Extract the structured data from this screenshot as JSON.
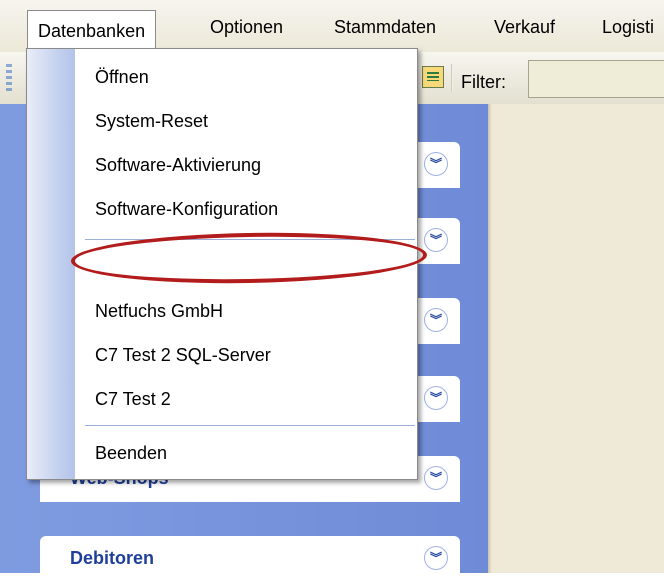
{
  "menubar": {
    "items": [
      "Datenbanken",
      "Optionen",
      "Stammdaten",
      "Verkauf",
      "Logisti"
    ]
  },
  "toolbar": {
    "filter_label": "Filter:",
    "filter_value": ""
  },
  "groups": [
    {
      "title": ""
    },
    {
      "title": ""
    },
    {
      "title": ""
    },
    {
      "title": ""
    },
    {
      "title": "Web-Shops"
    },
    {
      "title": "Debitoren"
    }
  ],
  "dropdown": {
    "items": [
      "Öffnen",
      "System-Reset",
      "Software-Aktivierung",
      "Software-Konfiguration",
      "Netfuchs GmbH",
      "C7 Test 2 SQL-Server",
      "C7 Test 2",
      "Beenden"
    ]
  },
  "colors": {
    "highlight_ring": "#b31c1c",
    "panel_blue": "#7f9be0",
    "group_title": "#1f3f9c"
  }
}
